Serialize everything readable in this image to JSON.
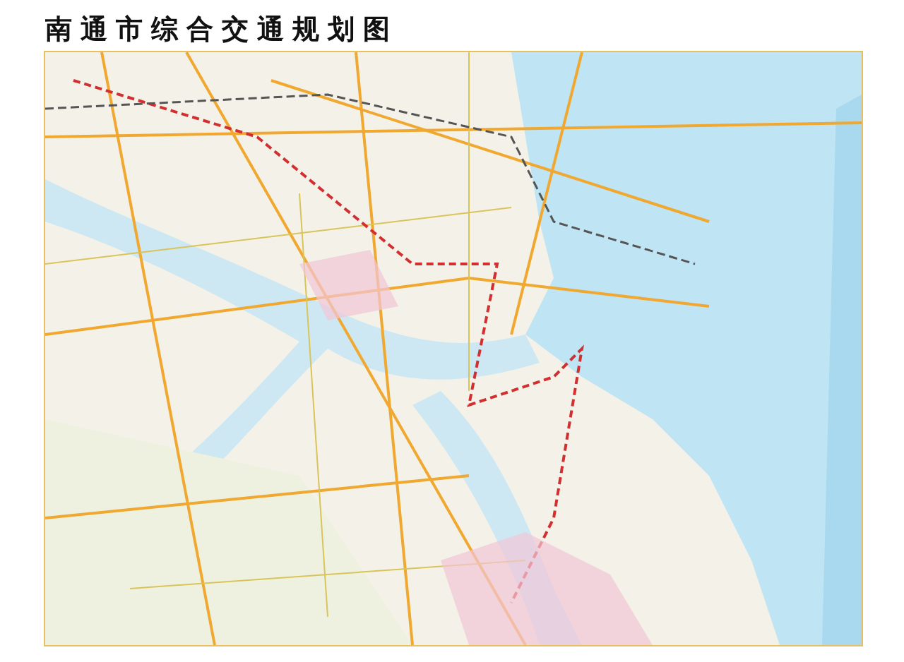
{
  "title": "南通市综合交通规划图"
}
